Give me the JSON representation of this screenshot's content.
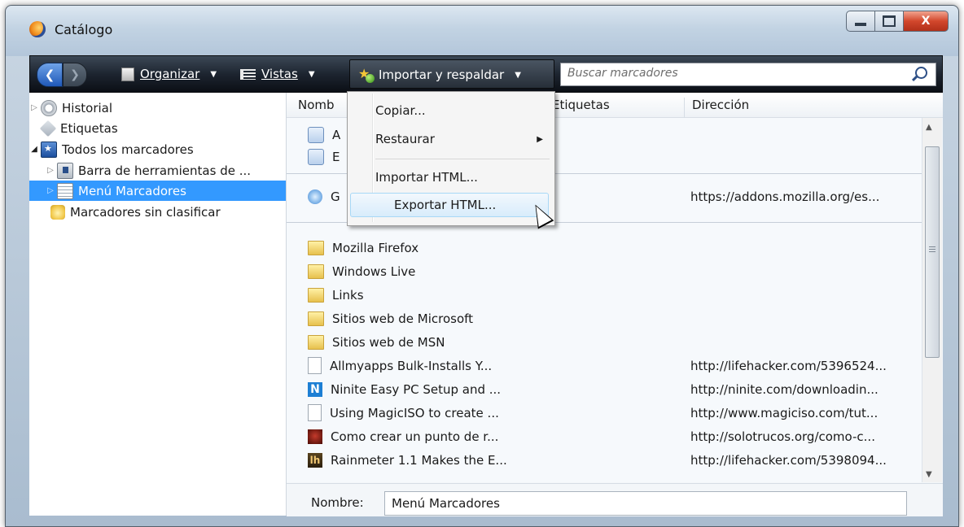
{
  "window": {
    "title": "Catálogo",
    "close_label": "X"
  },
  "toolbar": {
    "organize_label": "Organizar",
    "views_label": "Vistas",
    "import_label": "Importar y respaldar",
    "search_placeholder": "Buscar marcadores"
  },
  "sidebar": {
    "items": [
      {
        "label": "Historial",
        "icon": "history-icon"
      },
      {
        "label": "Etiquetas",
        "icon": "tag-icon"
      },
      {
        "label": "Todos los marcadores",
        "icon": "all-bookmarks-icon"
      },
      {
        "label": "Barra de herramientas de ...",
        "icon": "toolbar-folder-icon"
      },
      {
        "label": "Menú Marcadores",
        "icon": "bookmarks-menu-icon",
        "selected": true
      },
      {
        "label": "Marcadores sin clasificar",
        "icon": "unsorted-bookmarks-icon"
      }
    ]
  },
  "columns": {
    "name": "Nomb",
    "tags": "Etiquetas",
    "address": "Dirección"
  },
  "list": {
    "top_items": [
      {
        "name": "A",
        "url": ""
      },
      {
        "name": "E",
        "url": ""
      }
    ],
    "addon_item": {
      "name": "G",
      "url": "https://addons.mozilla.org/es..."
    },
    "items": [
      {
        "name": "Mozilla Firefox",
        "url": "",
        "icon": "folder-icon"
      },
      {
        "name": "Windows Live",
        "url": "",
        "icon": "folder-icon"
      },
      {
        "name": "Links",
        "url": "",
        "icon": "folder-icon"
      },
      {
        "name": "Sitios web de Microsoft",
        "url": "",
        "icon": "folder-icon"
      },
      {
        "name": "Sitios web de MSN",
        "url": "",
        "icon": "folder-icon"
      },
      {
        "name": "Allmyapps Bulk-Installs Y...",
        "url": "http://lifehacker.com/5396524...",
        "icon": "page-icon"
      },
      {
        "name": "Ninite Easy PC Setup and ...",
        "url": "http://ninite.com/downloadin...",
        "icon": "ninite-icon"
      },
      {
        "name": "Using MagicISO to create ...",
        "url": "http://www.magiciso.com/tut...",
        "icon": "page-icon"
      },
      {
        "name": "Como crear un punto de r...",
        "url": "http://solotrucos.org/como-c...",
        "icon": "solotrucos-icon"
      },
      {
        "name": "Rainmeter 1.1 Makes the E...",
        "url": "http://lifehacker.com/5398094...",
        "icon": "lifehacker-icon"
      }
    ]
  },
  "footer": {
    "name_label": "Nombre:",
    "name_value": "Menú Marcadores"
  },
  "menu": {
    "items": [
      {
        "label": "Copiar...",
        "has_submenu": false
      },
      {
        "label": "Restaurar",
        "has_submenu": true
      },
      {
        "label": "Importar HTML...",
        "has_submenu": false
      },
      {
        "label": "Exportar HTML...",
        "has_submenu": false,
        "hovered": true
      }
    ]
  },
  "icons": {
    "ninite_glyph": "N",
    "lifehacker_glyph": "lh"
  }
}
